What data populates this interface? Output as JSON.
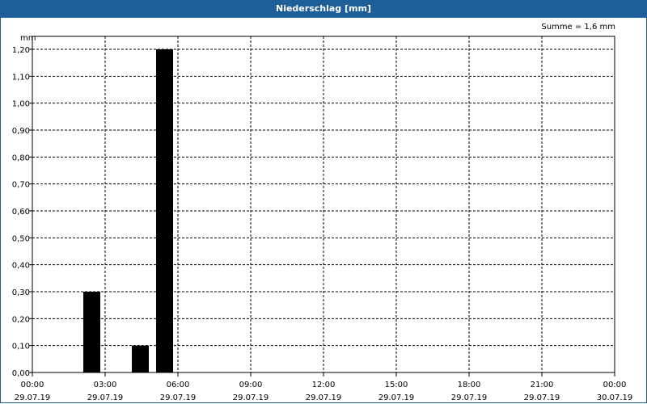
{
  "window": {
    "title": "Niederschlag [mm]"
  },
  "chart_data": {
    "type": "bar",
    "unit_label": "mm",
    "sum_label": "Summe = 1,6 mm",
    "ylim": [
      0,
      1.2
    ],
    "y_ticks": [
      "0,00",
      "0,10",
      "0,20",
      "0,30",
      "0,40",
      "0,50",
      "0,60",
      "0,70",
      "0,80",
      "0,90",
      "1,00",
      "1,10",
      "1,20"
    ],
    "x_ticks": [
      {
        "time": "00:00",
        "date": "29.07.19"
      },
      {
        "time": "03:00",
        "date": "29.07.19"
      },
      {
        "time": "06:00",
        "date": "29.07.19"
      },
      {
        "time": "09:00",
        "date": "29.07.19"
      },
      {
        "time": "12:00",
        "date": "29.07.19"
      },
      {
        "time": "15:00",
        "date": "29.07.19"
      },
      {
        "time": "18:00",
        "date": "29.07.19"
      },
      {
        "time": "21:00",
        "date": "29.07.19"
      },
      {
        "time": "00:00",
        "date": "30.07.19"
      }
    ],
    "bars": [
      {
        "start": "29.07.19 02:00",
        "end": "29.07.19 03:00",
        "value": 0.3
      },
      {
        "start": "29.07.19 04:00",
        "end": "29.07.19 05:00",
        "value": 0.1
      },
      {
        "start": "29.07.19 05:00",
        "end": "29.07.19 06:00",
        "value": 1.2
      }
    ],
    "grid": true,
    "color": "#000000"
  }
}
